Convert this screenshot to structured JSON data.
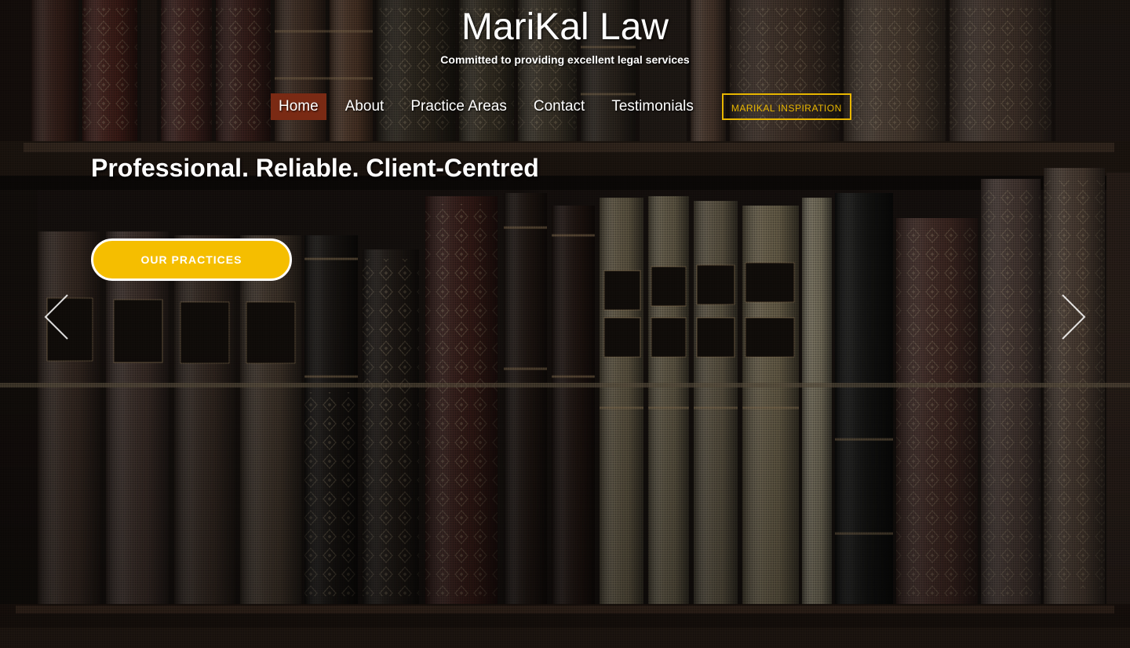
{
  "site": {
    "title": "MariKal Law",
    "tagline": "Committed to providing excellent legal services"
  },
  "nav": {
    "items": [
      {
        "label": "Home",
        "active": true
      },
      {
        "label": "About",
        "active": false
      },
      {
        "label": "Practice Areas",
        "active": false
      },
      {
        "label": "Contact",
        "active": false
      },
      {
        "label": "Testimonials",
        "active": false
      }
    ],
    "cta_label": "MARIKAL INSPIRATION"
  },
  "hero": {
    "headline": "Professional. Reliable. Client-Centred",
    "button_label": "OUR PRACTICES",
    "prev_icon": "chevron-left-icon",
    "next_icon": "chevron-right-icon",
    "background": "bookshelf-image"
  },
  "colors": {
    "accent": "#f5be00",
    "active_nav": "#7a2a14",
    "cta_border": "#e8b600",
    "text": "#ffffff"
  }
}
